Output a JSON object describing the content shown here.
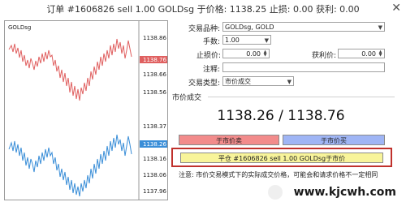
{
  "window": {
    "title": "订单 #1606826 sell 1.00 GOLDsg 于价格: 1138.25 止损: 0.00 获利: 0.00",
    "close_glyph": "✕"
  },
  "chart": {
    "symbol_label": "GOLDsg",
    "price_ticks_top": [
      "1138.86",
      "1138.76",
      "1138.66",
      "1138.56"
    ],
    "price_ticks_bottom": [
      "1138.37",
      "1138.26",
      "1138.16",
      "1138.06",
      "1137.96"
    ],
    "ask_marker": "1138.76",
    "bid_marker": "1138.26",
    "ask_color": "#e06060",
    "bid_color": "#3a8ed8"
  },
  "form": {
    "symbol_label": "交易品种:",
    "symbol_value": "GOLDsg, GOLD",
    "volume_label": "手数:",
    "volume_value": "1.00",
    "sl_label": "止损价:",
    "sl_value": "0.00",
    "tp_label": "获利价:",
    "tp_value": "0.00",
    "comment_label": "注释:",
    "comment_value": "",
    "type_label": "交易类型:",
    "type_value": "市价成交"
  },
  "market": {
    "section_title": "市价成交",
    "prices": "1138.26 / 1138.76",
    "sell_button": "于市价卖",
    "buy_button": "于市价买",
    "close_button": "平仓 #1606826 sell 1.00 GOLDsg于市价",
    "note": "注意: 市价交易模式下的实际成交价格，可能会和请求价格不一定相同"
  },
  "watermark": "www.kjcwh.com"
}
